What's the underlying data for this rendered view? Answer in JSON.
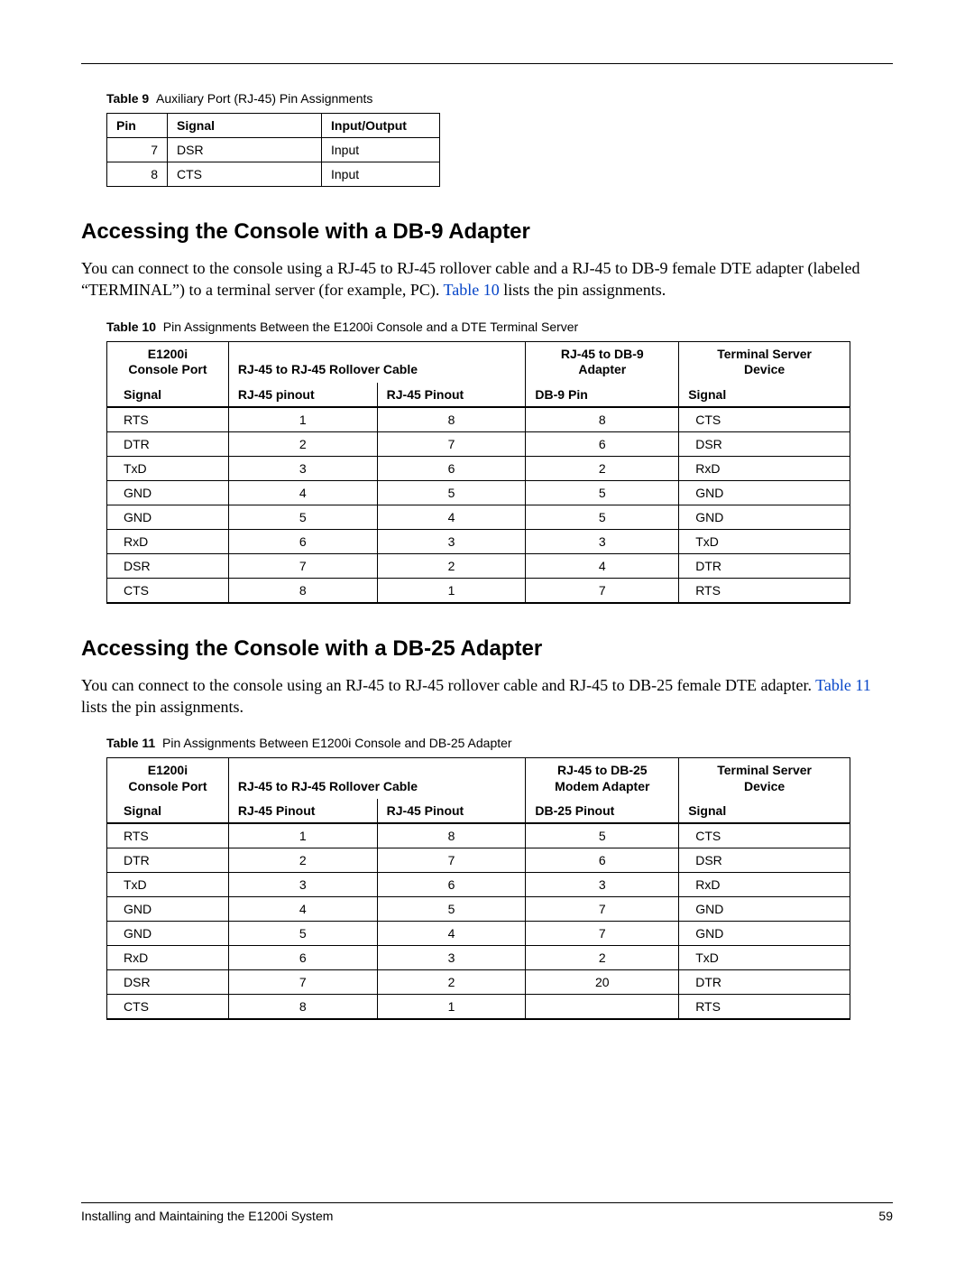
{
  "footer": {
    "title": "Installing and Maintaining the E1200i System",
    "page": "59"
  },
  "table9": {
    "caption_num": "Table 9",
    "caption_text": "Auxiliary Port (RJ-45) Pin Assignments",
    "headers": [
      "Pin",
      "Signal",
      "Input/Output"
    ],
    "rows": [
      {
        "pin": "7",
        "signal": "DSR",
        "io": "Input"
      },
      {
        "pin": "8",
        "signal": "CTS",
        "io": "Input"
      }
    ]
  },
  "section_db9": {
    "heading": "Accessing the Console with a DB-9 Adapter",
    "p_before": "You can connect to the console using a RJ-45 to RJ-45 rollover cable and a RJ-45 to DB-9 female DTE adapter (labeled “TERMINAL”) to a terminal server (for example, PC). ",
    "xref": "Table 10",
    "p_after": " lists the pin assignments."
  },
  "table10": {
    "caption_num": "Table 10",
    "caption_text": "Pin Assignments Between the E1200i Console and a DTE Terminal Server",
    "super": {
      "c1a": "E1200i",
      "c1b": "Console Port",
      "c2": "RJ-45 to RJ-45 Rollover Cable",
      "c3a": "RJ-45 to DB-9",
      "c3b": "Adapter",
      "c4a": "Terminal Server",
      "c4b": "Device"
    },
    "sub": [
      "Signal",
      "RJ-45 pinout",
      "RJ-45 Pinout",
      "DB-9 Pin",
      "Signal"
    ],
    "rows": [
      [
        "RTS",
        "1",
        "8",
        "8",
        "CTS"
      ],
      [
        "DTR",
        "2",
        "7",
        "6",
        "DSR"
      ],
      [
        "TxD",
        "3",
        "6",
        "2",
        "RxD"
      ],
      [
        "GND",
        "4",
        "5",
        "5",
        "GND"
      ],
      [
        "GND",
        "5",
        "4",
        "5",
        "GND"
      ],
      [
        "RxD",
        "6",
        "3",
        "3",
        "TxD"
      ],
      [
        "DSR",
        "7",
        "2",
        "4",
        "DTR"
      ],
      [
        "CTS",
        "8",
        "1",
        "7",
        "RTS"
      ]
    ]
  },
  "section_db25": {
    "heading": "Accessing the Console with a DB-25 Adapter",
    "p_before": "You can connect to the console using an RJ-45 to RJ-45 rollover cable and RJ-45 to DB-25 female DTE adapter. ",
    "xref": "Table 11",
    "p_after": " lists the pin assignments."
  },
  "table11": {
    "caption_num": "Table 11",
    "caption_text": "Pin Assignments Between E1200i Console and DB-25 Adapter",
    "super": {
      "c1a": "E1200i",
      "c1b": "Console Port",
      "c2": "RJ-45 to RJ-45 Rollover Cable",
      "c3a": "RJ-45 to DB-25",
      "c3b": "Modem Adapter",
      "c4a": "Terminal Server",
      "c4b": "Device"
    },
    "sub": [
      "Signal",
      "RJ-45 Pinout",
      "RJ-45 Pinout",
      "DB-25 Pinout",
      "Signal"
    ],
    "rows": [
      [
        "RTS",
        "1",
        "8",
        "5",
        "CTS"
      ],
      [
        "DTR",
        "2",
        "7",
        "6",
        "DSR"
      ],
      [
        "TxD",
        "3",
        "6",
        "3",
        "RxD"
      ],
      [
        "GND",
        "4",
        "5",
        "7",
        "GND"
      ],
      [
        "GND",
        "5",
        "4",
        "7",
        "GND"
      ],
      [
        "RxD",
        "6",
        "3",
        "2",
        "TxD"
      ],
      [
        "DSR",
        "7",
        "2",
        "20",
        "DTR"
      ],
      [
        "CTS",
        "8",
        "1",
        "",
        "RTS"
      ]
    ]
  }
}
